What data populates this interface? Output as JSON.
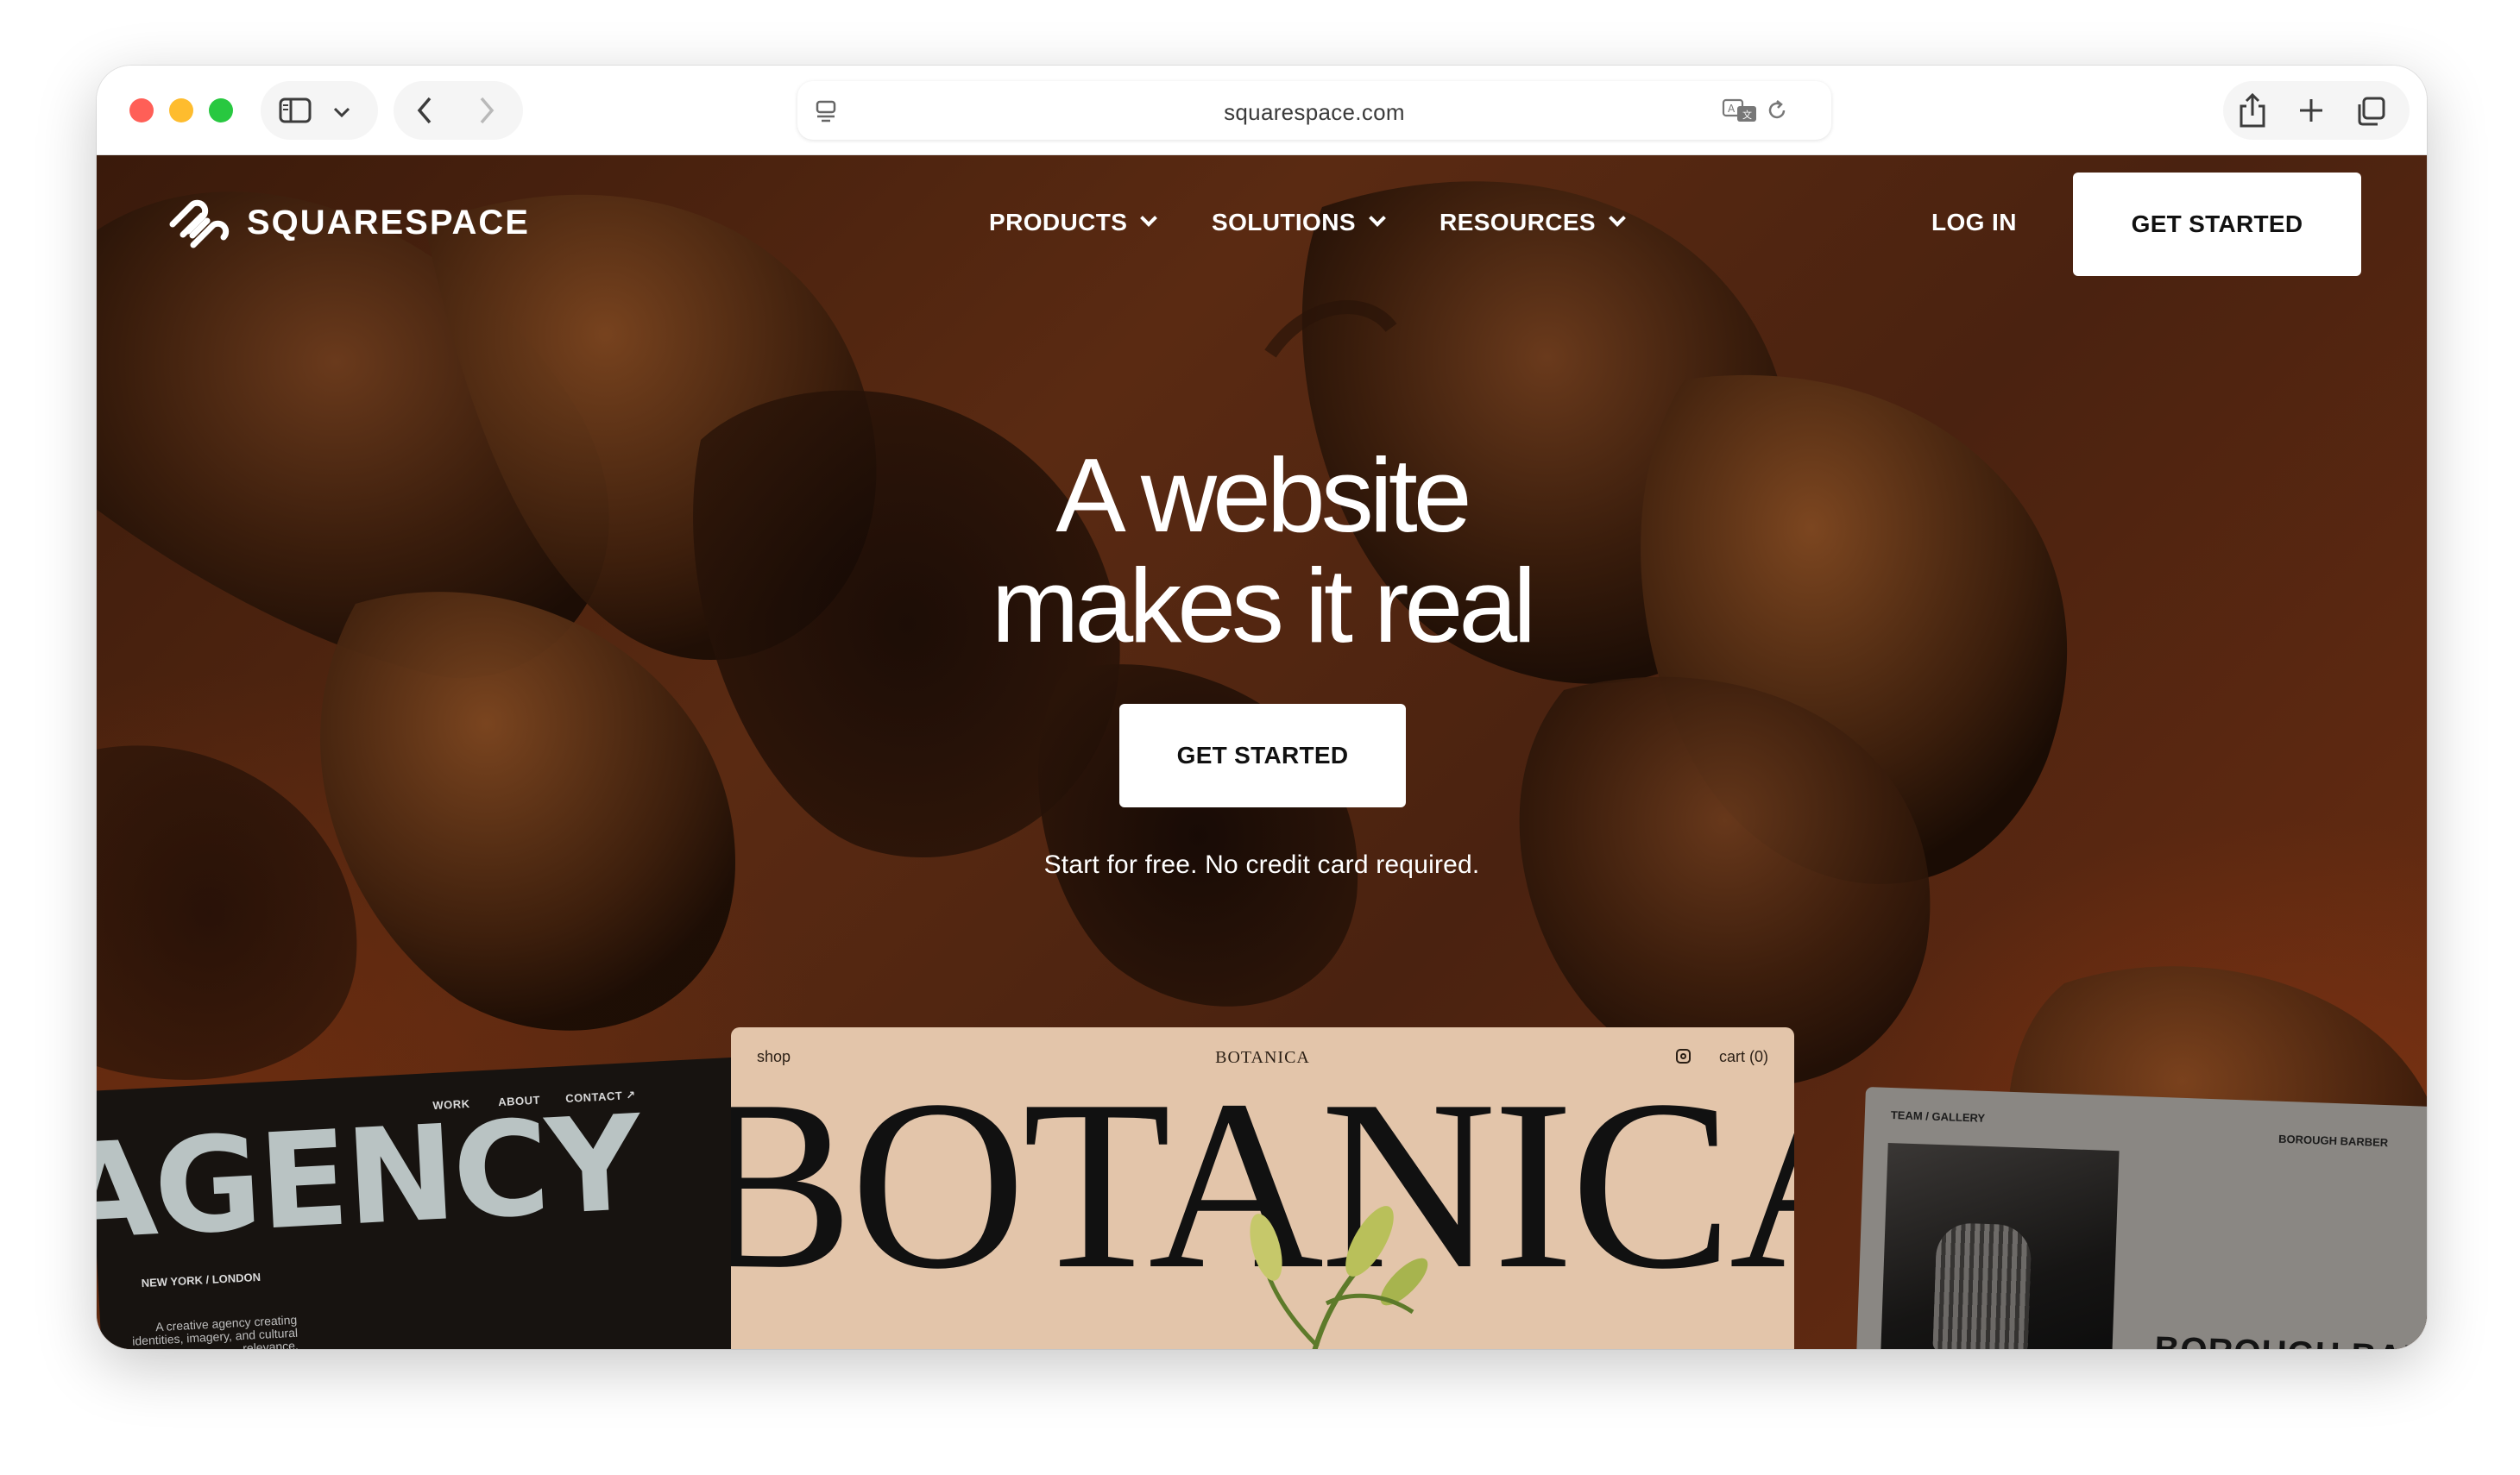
{
  "browser": {
    "url": "squarespace.com"
  },
  "site": {
    "logo_text": "SQUARESPACE",
    "nav": [
      {
        "label": "PRODUCTS"
      },
      {
        "label": "SOLUTIONS"
      },
      {
        "label": "RESOURCES"
      }
    ],
    "login_label": "LOG IN",
    "header_cta": "GET STARTED"
  },
  "hero": {
    "headline_line1": "A website",
    "headline_line2": "makes it real",
    "cta": "GET STARTED",
    "subtext": "Start for free. No credit card required."
  },
  "previews": {
    "agency": {
      "big_text": "AGENCY",
      "nav": [
        "WORK",
        "ABOUT",
        "CONTACT ↗"
      ],
      "location": "NEW YORK / LONDON",
      "tagline": "A creative agency creating identities, imagery, and cultural relevance."
    },
    "botanica": {
      "shop": "shop",
      "brand": "BOTANICA",
      "cart": "cart (0)",
      "big_text": "BOTANICA"
    },
    "barber": {
      "nav": "TEAM  /  GALLERY",
      "brand": "BOROUGH BARBER",
      "big_text": "BOROUGH BAR"
    }
  },
  "colors": {
    "close": "#ff5f57",
    "minimize": "#febc2e",
    "zoom": "#28c840",
    "hero_bg": "#4a2210"
  }
}
